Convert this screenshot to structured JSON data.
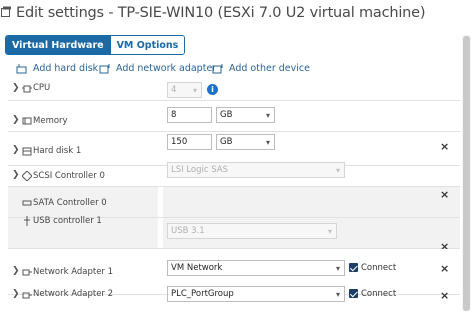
{
  "window": {
    "title": "Edit settings - TP-SIE-WIN10 (ESXi 7.0 U2 virtual machine)",
    "icon": "edit-vm-icon"
  },
  "tabs": [
    {
      "label": "Virtual Hardware",
      "active": true
    },
    {
      "label": "VM Options",
      "active": false
    }
  ],
  "actions": {
    "add_hard_disk": "Add hard disk",
    "add_network_adapter": "Add network adapter",
    "add_other_device": "Add other device"
  },
  "hardware": {
    "cpu": {
      "label": "CPU",
      "value": "4",
      "icon": "cpu-icon"
    },
    "memory": {
      "label": "Memory",
      "value": "8",
      "unit": "GB",
      "icon": "memory-icon"
    },
    "hard_disk_1": {
      "label": "Hard disk 1",
      "value": "150",
      "unit": "GB",
      "icon": "disk-icon"
    },
    "scsi": {
      "label": "SCSI Controller 0",
      "value": "LSI Logic SAS",
      "icon": "controller-icon"
    },
    "sata": {
      "label": "SATA Controller 0",
      "icon": "controller-icon"
    },
    "usb": {
      "label": "USB controller 1",
      "value": "USB 3.1",
      "icon": "usb-icon"
    },
    "net1": {
      "label": "Network Adapter 1",
      "value": "VM Network",
      "connect_label": "Connect",
      "connected": true,
      "icon": "network-icon"
    },
    "net2": {
      "label": "Network Adapter 2",
      "value": "PLC_PortGroup",
      "connect_label": "Connect",
      "connected": true,
      "icon": "network-icon"
    }
  },
  "colors": {
    "accent": "#1b6aa5",
    "link": "#2a6496",
    "info": "#1b74c8",
    "checkbox": "#1c3f63"
  }
}
